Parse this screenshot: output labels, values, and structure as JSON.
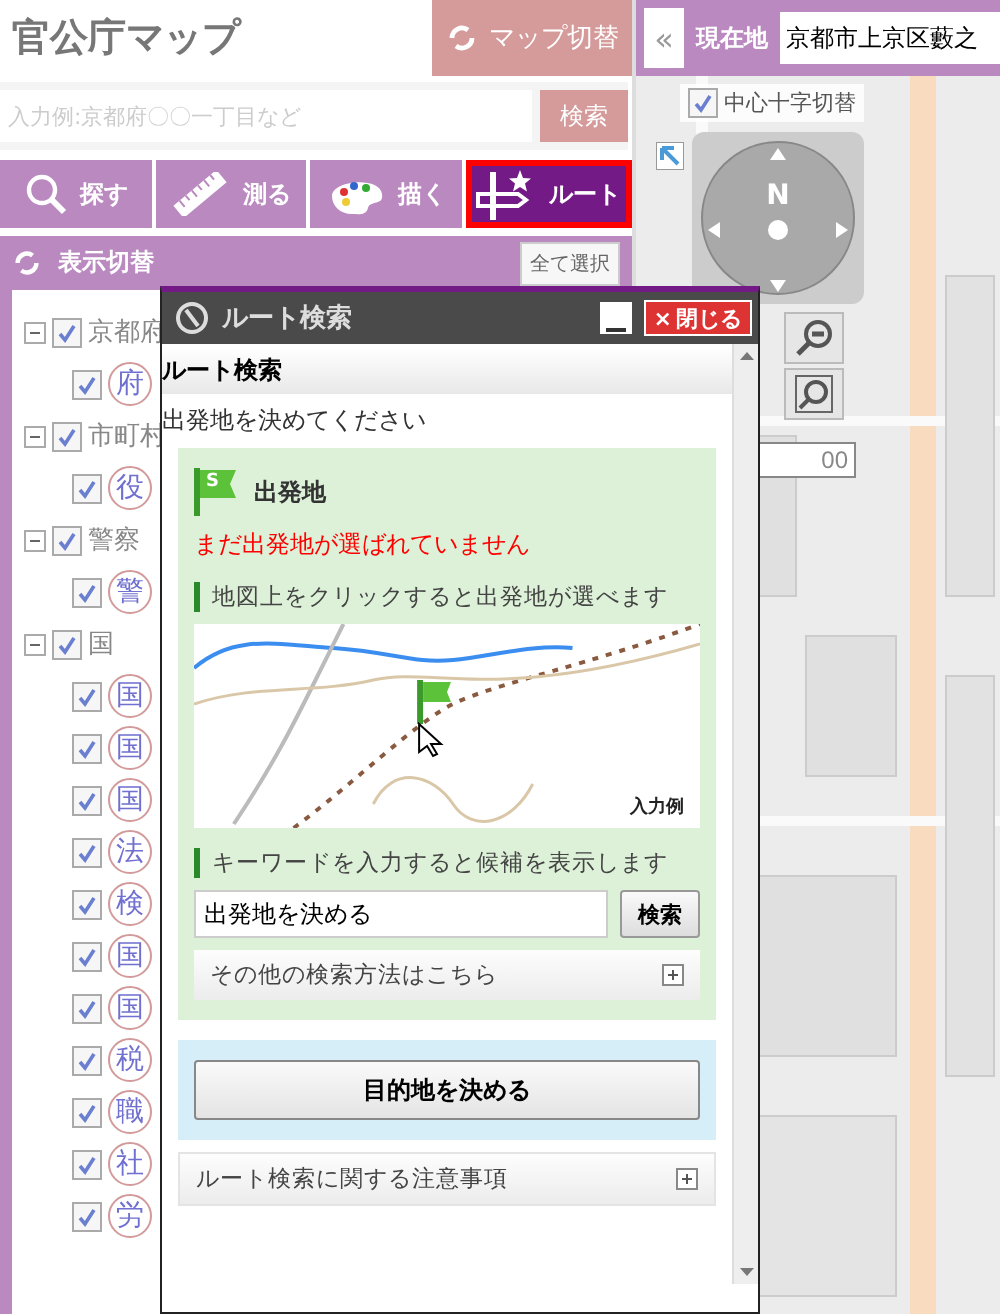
{
  "app_title": "官公庁マップ",
  "map_switch_button": "マップ切替",
  "collapse_button": "«",
  "location": {
    "label": "現在地",
    "value": "京都市上京区藪之"
  },
  "search": {
    "placeholder": "入力例:京都府〇〇一丁目など",
    "button": "検索"
  },
  "tabs": [
    {
      "label": "探す",
      "kind": "search",
      "selected": false
    },
    {
      "label": "測る",
      "kind": "measure",
      "selected": false
    },
    {
      "label": "描く",
      "kind": "draw",
      "selected": false
    },
    {
      "label": "ルート",
      "kind": "route",
      "selected": true
    }
  ],
  "panel": {
    "title": "表示切替",
    "select_all_button": "全て選択"
  },
  "tree": [
    {
      "label": "京都府",
      "checked": true,
      "expanded": true,
      "children": [
        {
          "label": "府",
          "checked": true
        }
      ]
    },
    {
      "label": "市町村",
      "checked": true,
      "expanded": true,
      "children": [
        {
          "label": "役",
          "checked": true
        }
      ]
    },
    {
      "label": "警察",
      "checked": true,
      "expanded": true,
      "children": [
        {
          "label": "警",
          "checked": true
        }
      ]
    },
    {
      "label": "国",
      "checked": true,
      "expanded": true,
      "children": [
        {
          "label": "国",
          "checked": true
        },
        {
          "label": "国",
          "checked": true
        },
        {
          "label": "国",
          "checked": true
        },
        {
          "label": "法",
          "checked": true
        },
        {
          "label": "検",
          "checked": true
        },
        {
          "label": "国",
          "checked": true
        },
        {
          "label": "国",
          "checked": true
        },
        {
          "label": "税",
          "checked": true
        },
        {
          "label": "職",
          "checked": true
        },
        {
          "label": "社",
          "checked": true
        },
        {
          "label": "労",
          "checked": true
        }
      ]
    }
  ],
  "map": {
    "crosshair_toggle": {
      "label": "中心十字切替",
      "checked": true
    },
    "compass_label": "N",
    "scale_value": "00"
  },
  "dialog": {
    "title": "ルート検索",
    "close_glyph": "×",
    "close_button": "閉じる",
    "heading": "ルート検索",
    "instruction": "出発地を決めてください",
    "origin": {
      "flag_letter": "S",
      "title": "出発地",
      "status": "まだ出発地が選ばれていません",
      "map_hint": "地図上をクリックすると出発地が選べます",
      "example_label": "入力例",
      "keyword_hint": "キーワードを入力すると候補を表示します",
      "keyword_value": "出発地を決める",
      "search_button": "検索",
      "more_methods": "その他の検索方法はこちら"
    },
    "destination_button": "目的地を決める",
    "notes": "ルート検索に関する注意事項"
  }
}
